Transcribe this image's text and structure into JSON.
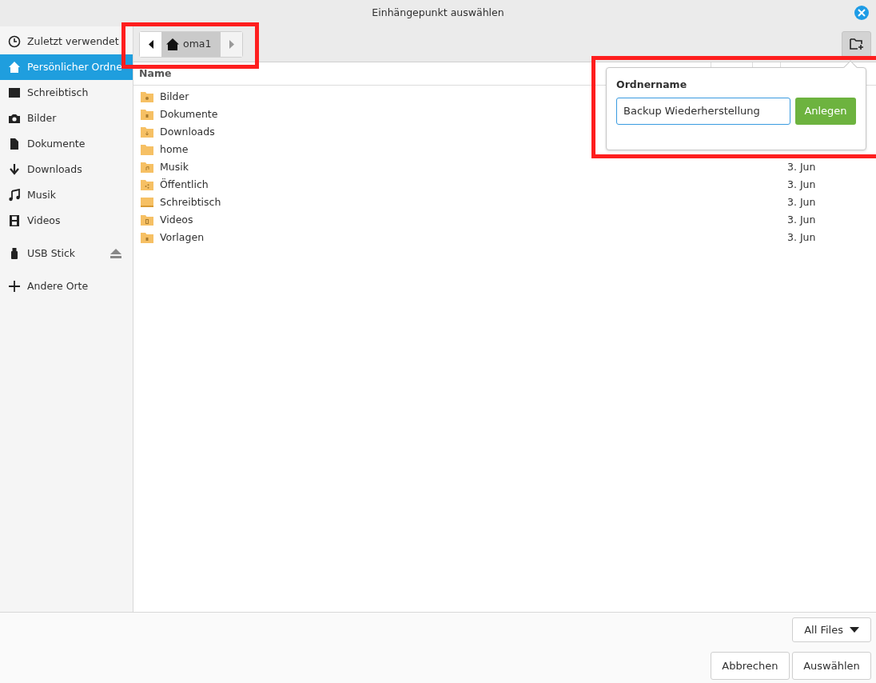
{
  "window": {
    "title": "Einhängepunkt auswählen"
  },
  "sidebar": {
    "places": [
      {
        "label": "Zuletzt verwendet",
        "kind": "clock",
        "selected": false
      },
      {
        "label": "Persönlicher Ordne",
        "kind": "home",
        "selected": true
      },
      {
        "label": "Schreibtisch",
        "kind": "desktop",
        "selected": false
      },
      {
        "label": "Bilder",
        "kind": "camera",
        "selected": false
      },
      {
        "label": "Dokumente",
        "kind": "document",
        "selected": false
      },
      {
        "label": "Downloads",
        "kind": "download",
        "selected": false
      },
      {
        "label": "Musik",
        "kind": "music",
        "selected": false
      },
      {
        "label": "Videos",
        "kind": "film",
        "selected": false
      }
    ],
    "devices": [
      {
        "label": "USB Stick",
        "kind": "usb",
        "ejectable": true
      }
    ],
    "other": [
      {
        "label": "Andere Orte",
        "kind": "plus",
        "selected": false
      }
    ]
  },
  "path_bar": {
    "segments": [
      {
        "label": "oma1",
        "kind": "home",
        "selected": true
      }
    ]
  },
  "file_list": {
    "columns": [
      "Name"
    ],
    "rows": [
      {
        "name": "Bilder",
        "kind": "camera"
      },
      {
        "name": "Dokumente",
        "kind": "document"
      },
      {
        "name": "Downloads",
        "kind": "download"
      },
      {
        "name": "home",
        "kind": "plain"
      },
      {
        "name": "Musik",
        "kind": "music",
        "modified": "3. Jun"
      },
      {
        "name": "Öffentlich",
        "kind": "share",
        "modified": "3. Jun"
      },
      {
        "name": "Schreibtisch",
        "kind": "desktop",
        "modified": "3. Jun"
      },
      {
        "name": "Videos",
        "kind": "film",
        "modified": "3. Jun"
      },
      {
        "name": "Vorlagen",
        "kind": "document",
        "modified": "3. Jun"
      }
    ]
  },
  "new_folder_popover": {
    "label": "Ordnername",
    "value": "Backup Wiederherstellung",
    "button": "Anlegen"
  },
  "filter": {
    "value": "All Files"
  },
  "buttons": [
    "Abbrechen",
    "Auswählen"
  ],
  "annotations": [
    {
      "kind": "frame"
    },
    {
      "kind": "frame"
    }
  ]
}
